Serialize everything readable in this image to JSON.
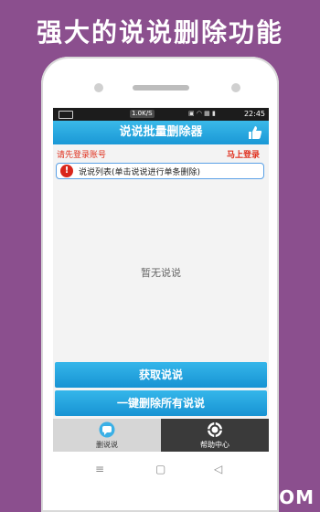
{
  "promo": {
    "headline": "强大的说说删除功能"
  },
  "statusbar": {
    "speed": "1.0K/S",
    "time": "22:45"
  },
  "app": {
    "title": "说说批量删除器",
    "login_prompt": "请先登录账号",
    "login_link": "马上登录",
    "list_header": "说说列表(单击说说进行单条删除)",
    "empty_text": "暂无说说",
    "fetch_button": "获取说说",
    "delete_all_button": "一键删除所有说说"
  },
  "tabs": [
    {
      "label": "删说说",
      "icon": "chat-bubble-icon"
    },
    {
      "label": "帮助中心",
      "icon": "help-center-icon"
    }
  ],
  "watermark": "ITMOP.COM",
  "colors": {
    "background": "#8b4f8e",
    "accent": "#1a98d6",
    "alert": "#e0301e"
  }
}
